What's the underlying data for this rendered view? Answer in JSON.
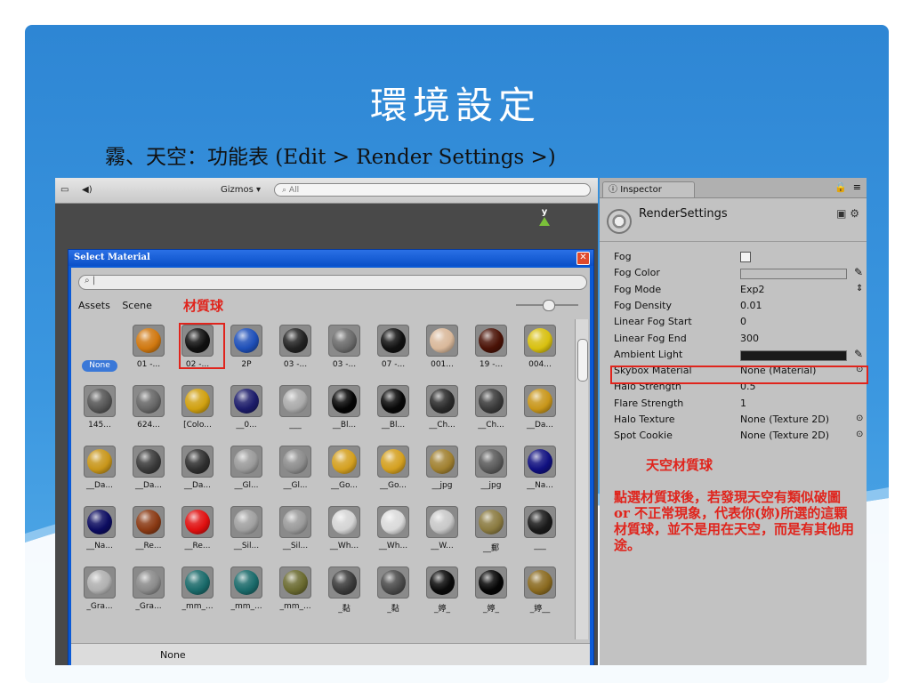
{
  "slide": {
    "title": "環境設定",
    "subtitle": "霧、天空：功能表 (Edit > Render Settings >)"
  },
  "scene_toolbar": {
    "gizmos_label": "Gizmos ▾",
    "search_placeholder": "All",
    "axis_label": "y"
  },
  "select_material": {
    "title": "Select Material",
    "search_value": "",
    "tabs": [
      "Assets",
      "Scene"
    ],
    "annotation": "材質球",
    "footer_selected": "None",
    "items": [
      {
        "label": "None",
        "kind": "none"
      },
      {
        "label": "01 -...",
        "color": "#d07810"
      },
      {
        "label": "02 -...",
        "color": "#101010"
      },
      {
        "label": "2P",
        "color": "#1e4fb8"
      },
      {
        "label": "03 -...",
        "color": "#222222"
      },
      {
        "label": "03 -...",
        "color": "#6a6a6a"
      },
      {
        "label": "07 -...",
        "color": "#111111"
      },
      {
        "label": "001...",
        "color": "#d9b89a"
      },
      {
        "label": "19 -...",
        "color": "#4a1206"
      },
      {
        "label": "004...",
        "color": "#d8c010"
      },
      {
        "label": "145...",
        "color": "#555555"
      },
      {
        "label": "624...",
        "color": "#666666"
      },
      {
        "label": "[Colo...",
        "color": "#d0a010"
      },
      {
        "label": "__0...",
        "color": "#1c1c6a"
      },
      {
        "label": "___",
        "color": "#aaaaaa"
      },
      {
        "label": "__Bl...",
        "color": "#050505"
      },
      {
        "label": "__Bl...",
        "color": "#080808"
      },
      {
        "label": "__Ch...",
        "color": "#2a2a2a"
      },
      {
        "label": "__Ch...",
        "color": "#3a3a3a"
      },
      {
        "label": "__Da...",
        "color": "#c8961a"
      },
      {
        "label": "__Da...",
        "color": "#c8961a"
      },
      {
        "label": "__Da...",
        "color": "#3a3a3a"
      },
      {
        "label": "__Da...",
        "color": "#2f2f2f"
      },
      {
        "label": "__Gl...",
        "color": "#9a9a9a"
      },
      {
        "label": "__Gl...",
        "color": "#8c8c8c"
      },
      {
        "label": "__Go...",
        "color": "#d4a020"
      },
      {
        "label": "__Go...",
        "color": "#d4a020"
      },
      {
        "label": "__jpg",
        "color": "#a08030"
      },
      {
        "label": "__jpg",
        "color": "#5a5a5a"
      },
      {
        "label": "__Na...",
        "color": "#101080"
      },
      {
        "label": "__Na...",
        "color": "#0c0c60"
      },
      {
        "label": "__Re...",
        "color": "#8a3a14"
      },
      {
        "label": "__Re...",
        "color": "#e01010"
      },
      {
        "label": "__Sil...",
        "color": "#a0a0a0"
      },
      {
        "label": "__Sil...",
        "color": "#9a9a9a"
      },
      {
        "label": "__Wh...",
        "color": "#d4d4d4"
      },
      {
        "label": "__Wh...",
        "color": "#dadada"
      },
      {
        "label": "__W...",
        "color": "#c8c8c8"
      },
      {
        "label": "__郵",
        "color": "#8a7a40"
      },
      {
        "label": "___",
        "color": "#1a1a1a"
      },
      {
        "label": "_Gra...",
        "color": "#b0b0b0"
      },
      {
        "label": "_Gra...",
        "color": "#8a8a8a"
      },
      {
        "label": "_mm_...",
        "color": "#1a6a6a"
      },
      {
        "label": "_mm_...",
        "color": "#1a6a6a"
      },
      {
        "label": "_mm_...",
        "color": "#6a6a30"
      },
      {
        "label": "_黏",
        "color": "#3a3a3a"
      },
      {
        "label": "_黏",
        "color": "#4a4a4a"
      },
      {
        "label": "_婷_",
        "color": "#0a0a0a"
      },
      {
        "label": "_婷_",
        "color": "#050505"
      },
      {
        "label": "_婷__",
        "color": "#8a6a20"
      }
    ]
  },
  "inspector": {
    "tab_label": "Inspector",
    "component_name": "RenderSettings",
    "properties": [
      {
        "label": "Fog",
        "value": "",
        "type": "checkbox"
      },
      {
        "label": "Fog Color",
        "value": "",
        "type": "color",
        "color": "#c0c0c0"
      },
      {
        "label": "Fog Mode",
        "value": "Exp2",
        "type": "select"
      },
      {
        "label": "Fog Density",
        "value": "0.01",
        "type": "text"
      },
      {
        "label": "Linear Fog Start",
        "value": "0",
        "type": "text"
      },
      {
        "label": "Linear Fog End",
        "value": "300",
        "type": "text"
      },
      {
        "label": "Ambient Light",
        "value": "",
        "type": "color",
        "color": "#1a1a1a"
      },
      {
        "label": "Skybox Material",
        "value": "None (Material)",
        "type": "object"
      },
      {
        "label": "Halo Strength",
        "value": "0.5",
        "type": "text"
      },
      {
        "label": "Flare Strength",
        "value": "1",
        "type": "text"
      },
      {
        "label": "Halo Texture",
        "value": "None (Texture 2D)",
        "type": "object"
      },
      {
        "label": "Spot Cookie",
        "value": "None (Texture 2D)",
        "type": "object"
      }
    ],
    "annotation_title": "天空材質球",
    "annotation_note": "點選材質球後，若發現天空有類似破圖 or 不正常現象，代表你(妳)所選的這顆材質球，並不是用在天空，而是有其他用途。"
  },
  "colors": {
    "slide_blue": "#3b97e0",
    "annotation_red": "#e0241c",
    "dialog_blue": "#0a5ad6"
  }
}
